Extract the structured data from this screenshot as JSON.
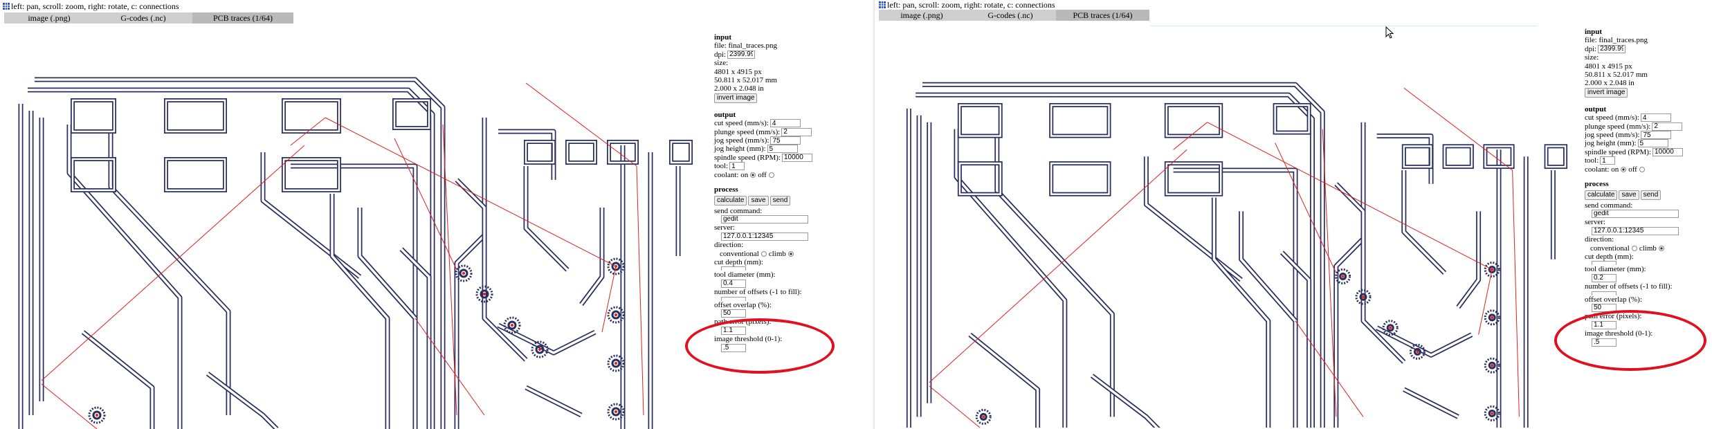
{
  "hint": "left: pan, scroll: zoom, right: rotate, c: connections",
  "tabs": [
    "image (.png)",
    "G-codes (.nc)",
    "PCB traces (1/64)"
  ],
  "colors": {
    "trace": "#2a2e5c",
    "connection": "#e02020",
    "ring": "#e01020",
    "tab_bg": "#cfcfcf"
  },
  "icons": {
    "app": "grid-icon",
    "cursor": "mouse-cursor-icon"
  },
  "left": {
    "input": {
      "title": "input",
      "file": "file: final_traces.png",
      "dpi_label": "dpi:",
      "dpi": "2399.99",
      "size_label": "size:",
      "px": "4801 x 4915 px",
      "mm": "50.811 x 52.017 mm",
      "in": "2.000 x 2.048 in",
      "invert": "invert image"
    },
    "output": {
      "title": "output",
      "cut_speed_label": "cut speed (mm/s):",
      "cut_speed": "4",
      "plunge_label": "plunge speed (mm/s):",
      "plunge": "2",
      "jog_speed_label": "jog speed (mm/s):",
      "jog_speed": "75",
      "jog_height_label": "jog height (mm):",
      "jog_height": "5",
      "spindle_label": "spindle speed (RPM):",
      "spindle": "10000",
      "tool_label": "tool:",
      "tool": "1",
      "coolant_label": "coolant:",
      "on": "on",
      "off": "off"
    },
    "process": {
      "title": "process",
      "calculate": "calculate",
      "save": "save",
      "send": "send",
      "send_cmd_label": "send command:",
      "send_cmd": "gedit",
      "server_label": "server:",
      "server": "127.0.0.1:12345",
      "direction_label": "direction:",
      "conventional": "conventional",
      "climb": "climb",
      "cut_depth_label": "cut depth (mm):",
      "tool_diameter_label": "tool diameter (mm):",
      "tool_diameter": "0.4",
      "offsets_label": "number of offsets (-1 to fill):",
      "overlap_label": "offset overlap (%):",
      "overlap": "50",
      "path_error_label": "path error (pixels):",
      "path_error": "1.1",
      "threshold_label": "image threshold (0-1):",
      "threshold": ".5"
    }
  },
  "right": {
    "input": {
      "title": "input",
      "file": "file: final_traces.png",
      "dpi_label": "dpi:",
      "dpi": "2399.99",
      "size_label": "size:",
      "px": "4801 x 4915 px",
      "mm": "50.811 x 52.017 mm",
      "in": "2.000 x 2.048 in",
      "invert": "invert image"
    },
    "output": {
      "title": "output",
      "cut_speed_label": "cut speed (mm/s):",
      "cut_speed": "4",
      "plunge_label": "plunge speed (mm/s):",
      "plunge": "2",
      "jog_speed_label": "jog speed (mm/s):",
      "jog_speed": "75",
      "jog_height_label": "jog height (mm):",
      "jog_height": "5",
      "spindle_label": "spindle speed (RPM):",
      "spindle": "10000",
      "tool_label": "tool:",
      "tool": "1",
      "coolant_label": "coolant:",
      "on": "on",
      "off": "off"
    },
    "process": {
      "title": "process",
      "calculate": "calculate",
      "save": "save",
      "send": "send",
      "send_cmd_label": "send command:",
      "send_cmd": "gedit",
      "server_label": "server:",
      "server": "127.0.0.1:12345",
      "direction_label": "direction:",
      "conventional": "conventional",
      "climb": "climb",
      "cut_depth_label": "cut depth (mm):",
      "tool_diameter_label": "tool diameter (mm):",
      "tool_diameter": "0.2",
      "offsets_label": "number of offsets (-1 to fill):",
      "overlap_label": "offset overlap (%):",
      "overlap": "50",
      "path_error_label": "path error (pixels):",
      "path_error": "1.1",
      "threshold_label": "image threshold (0-1):",
      "threshold": ".5"
    }
  }
}
